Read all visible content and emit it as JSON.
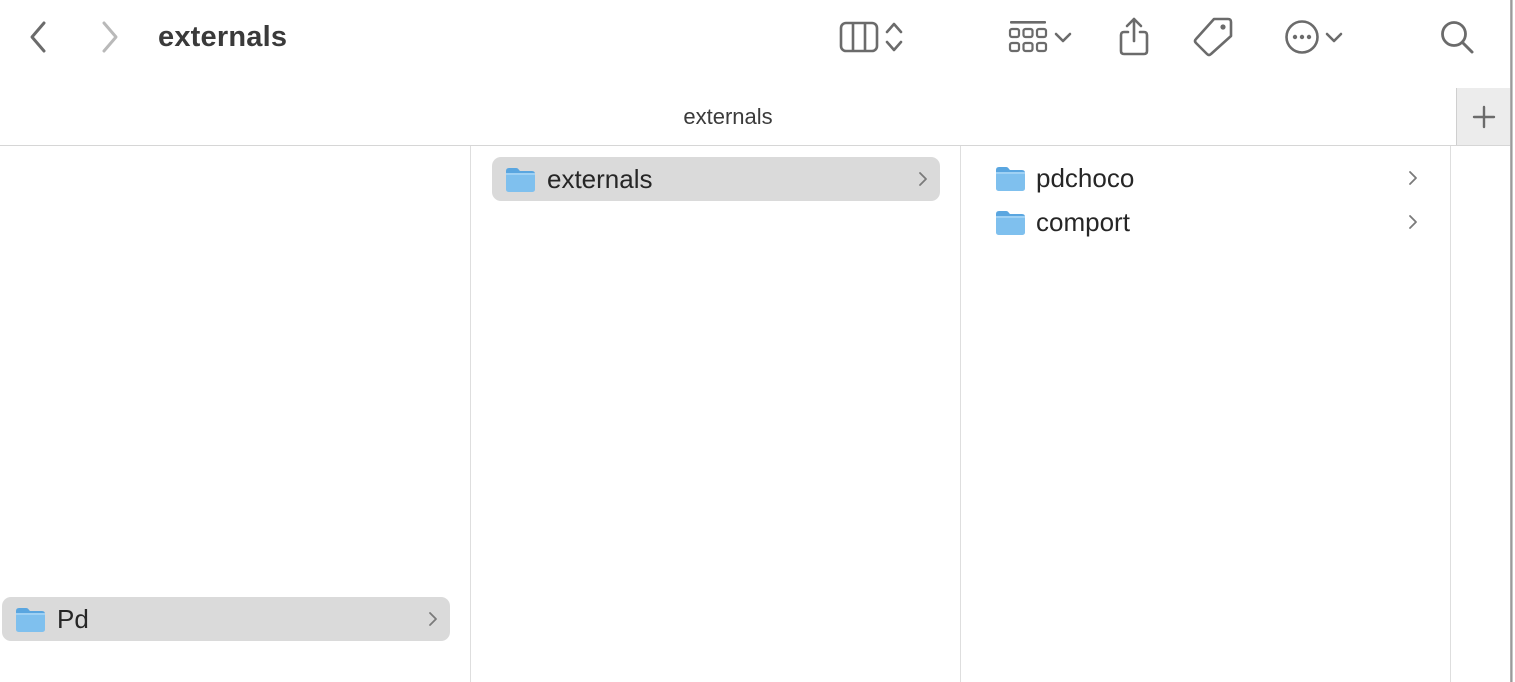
{
  "toolbar": {
    "title": "externals",
    "icons": [
      "chevron-left-icon",
      "chevron-right-icon",
      "column-view-icon",
      "view-switch-arrows-icon",
      "icon-grid-icon",
      "chevron-down-icon",
      "share-icon",
      "tag-icon",
      "more-ellipsis-icon",
      "chevron-down-icon",
      "search-icon"
    ]
  },
  "tabbar": {
    "tab_label": "externals",
    "new_tab_icon": "plus-icon"
  },
  "columns": [
    {
      "items": [
        {
          "label": "Pd",
          "selected": true,
          "has_children": true
        }
      ]
    },
    {
      "items": [
        {
          "label": "externals",
          "selected": true,
          "has_children": true
        }
      ]
    },
    {
      "items": [
        {
          "label": "pdchoco",
          "selected": false,
          "has_children": true
        },
        {
          "label": "comport",
          "selected": false,
          "has_children": true
        }
      ]
    }
  ],
  "colors": {
    "selection": "#dadada",
    "folder_body": "#7fc0ee",
    "folder_tab": "#5aa6e0",
    "icon_gray": "#6b6b6b"
  }
}
